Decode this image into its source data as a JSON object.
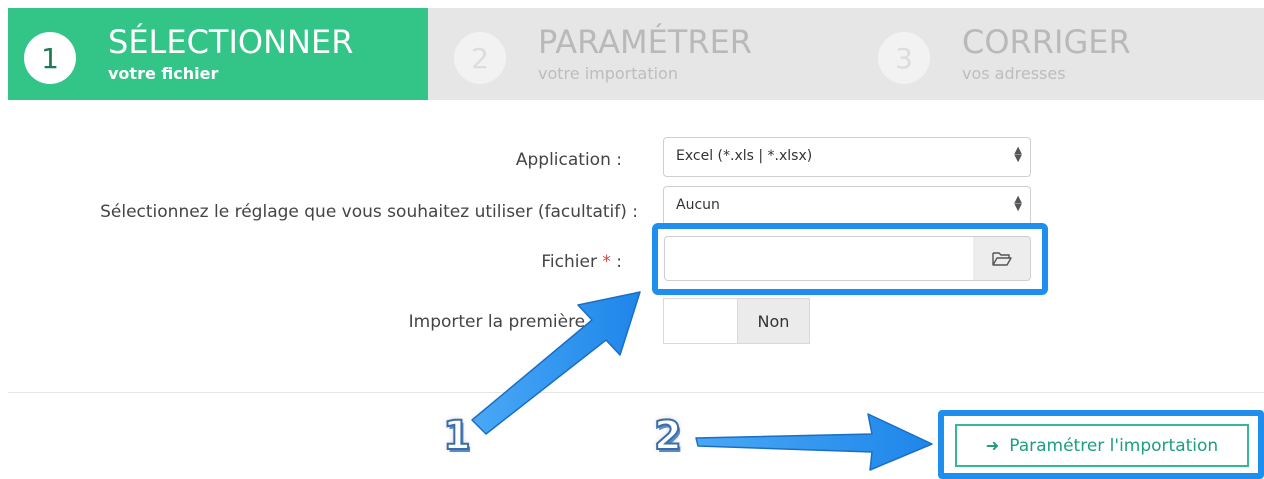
{
  "steps": [
    {
      "number": "1",
      "title": "SÉLECTIONNER",
      "subtitle": "votre fichier"
    },
    {
      "number": "2",
      "title": "PARAMÉTRER",
      "subtitle": "votre importation"
    },
    {
      "number": "3",
      "title": "CORRIGER",
      "subtitle": "vos adresses"
    }
  ],
  "form": {
    "application_label": "Application :",
    "application_value": "Excel (*.xls | *.xlsx)",
    "preset_label": "Sélectionnez le réglage que vous souhaitez utiliser (facultatif) :",
    "preset_value": "Aucun",
    "file_label": "Fichier",
    "file_required": "*",
    "file_colon": ":",
    "first_line_label": "Importer la première li",
    "first_line_value": "Non"
  },
  "submit": {
    "label": "Paramétrer l'importation"
  },
  "annotations": {
    "one": "1",
    "two": "2"
  },
  "colors": {
    "active_step": "#33c488",
    "highlight": "#1e8fef",
    "submit_border": "#33b89a"
  }
}
